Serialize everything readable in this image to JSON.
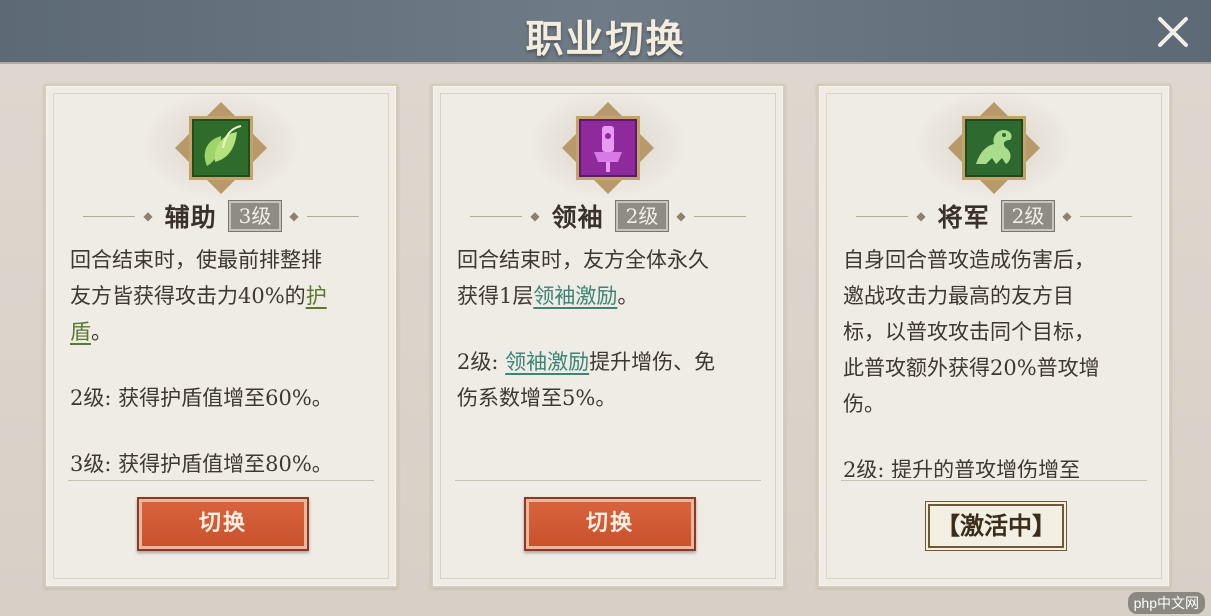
{
  "header": {
    "title": "职业切换"
  },
  "cards": [
    {
      "icon": "leaves-icon",
      "icon_color": "#2f6b2a",
      "name": "辅助",
      "level": "3级",
      "desc": {
        "l1a": "回合结束时，使最前排整排",
        "l1b": "友方皆获得攻击力40%的",
        "kw1": "护",
        "kw2": "盾",
        "l1c": "。",
        "l2": "2级: 获得护盾值增至60%。",
        "l3": "3级: 获得护盾值增至80%。"
      },
      "button": "切换"
    },
    {
      "icon": "banner-icon",
      "icon_color": "#8e2a9c",
      "name": "领袖",
      "level": "2级",
      "desc": {
        "l1a": "回合结束时，友方全体永久",
        "l1b": "获得1层",
        "kw1": "领袖激励",
        "l1c": "。",
        "l2a": "2级: ",
        "kw2": "领袖激励",
        "l2b": "提升增伤、免",
        "l2c": "伤系数增至5%。"
      },
      "button": "切换"
    },
    {
      "icon": "beast-icon",
      "icon_color": "#2e6a2f",
      "name": "将军",
      "level": "2级",
      "desc": {
        "l1": "自身回合普攻造成伤害后，",
        "l2": "邀战攻击力最高的友方目",
        "l3": "标，以普攻攻击同个目标，",
        "l4": "此普攻额外获得20%普攻增",
        "l5": "伤。",
        "l6": "2级: 提升的普攻增伤增至"
      },
      "status": "【激活中】"
    }
  ],
  "watermark": "php中文网",
  "colors": {
    "button": "#d05a33",
    "header": "#66727d",
    "keyword_green": "#5c7a2e",
    "keyword_teal": "#3b8477"
  }
}
